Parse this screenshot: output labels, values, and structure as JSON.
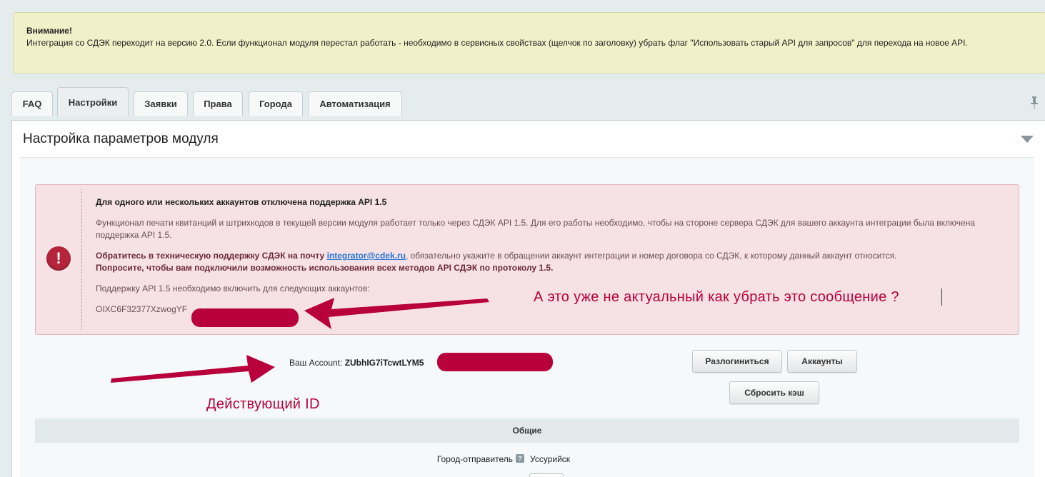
{
  "notice": {
    "title": "Внимание!",
    "text": "Интеграция со СДЭК переходит на версию 2.0. Если функционал модуля перестал работать - необходимо в сервисных свойствах (щелчок по заголовку) убрать флаг \"Использовать старый API для запросов\" для перехода на новое API."
  },
  "tabs": [
    {
      "label": "FAQ"
    },
    {
      "label": "Настройки"
    },
    {
      "label": "Заявки"
    },
    {
      "label": "Права"
    },
    {
      "label": "Города"
    },
    {
      "label": "Автоматизация"
    }
  ],
  "active_tab": "Настройки",
  "panel": {
    "title": "Настройка параметров модуля"
  },
  "alert": {
    "icon": "exclamation-icon",
    "headline": "Для одного или нескольких аккаунтов отключена поддержка API 1.5",
    "para1": "Функционал печати квитанций и штрихкодов в текущей версии модуля работает только через СДЭК API 1.5. Для его работы необходимо, чтобы на стороне сервера СДЭК для вашего аккаунта интеграции была включена поддержка API 1.5.",
    "para2_bold": "Обратитесь в техническую поддержку СДЭК на почту",
    "email": "integrator@cdek.ru",
    "para2_rest": ", обязательно укажите в обращении аккаунт интеграции и номер договора со СДЭК, к которому данный аккаунт относится.",
    "para2_bold2": "Попросите, чтобы вам подключили возможность использования всех методов API СДЭК по протоколу 1.5.",
    "para3": "Поддержку API 1.5 необходимо включить для следующих аккаунтов:",
    "account_partial": "OIXC6F32377XzwogYF"
  },
  "annotations": {
    "top": "А это уже не актуальный как убрать это сообщение ?",
    "bottom": "Действующий ID",
    "color": "#b8003c"
  },
  "account": {
    "label": "Ваш Account:",
    "value_partial": "ZUbhIG7iTcwtLYM5"
  },
  "buttons": {
    "logout": "Разлогиниться",
    "accounts": "Аккаунты",
    "reset_cache": "Сбросить кэш"
  },
  "section": {
    "title": "Общие",
    "fields": [
      {
        "label": "Город-отправитель",
        "help": "?",
        "value": "Уссурийск"
      }
    ]
  }
}
